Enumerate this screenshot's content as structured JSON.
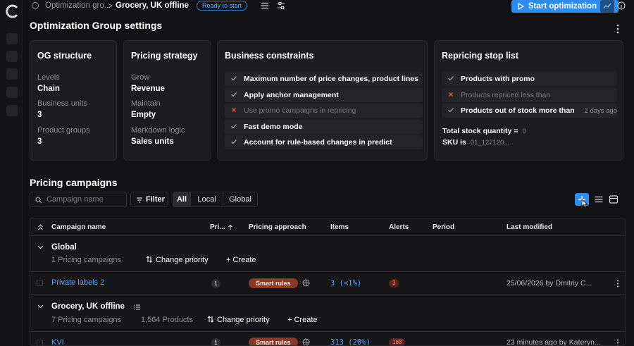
{
  "breadcrumb": {
    "parent": "Optimization gro...",
    "current": "Grocery, UK offline",
    "status": "Ready to start"
  },
  "header": {
    "start_label": "Start optimization"
  },
  "settings": {
    "title": "Optimization Group settings",
    "og_structure": {
      "title": "OG structure",
      "fields": [
        {
          "label": "Levels",
          "value": "Chain"
        },
        {
          "label": "Business units",
          "value": "3"
        },
        {
          "label": "Product groups",
          "value": "3"
        }
      ]
    },
    "pricing_strategy": {
      "title": "Pricing strategy",
      "fields": [
        {
          "label": "Grow",
          "value": "Revenue"
        },
        {
          "label": "Maintain",
          "value": "Empty"
        },
        {
          "label": "Markdown logic",
          "value": "Sales units"
        }
      ]
    },
    "business_constraints": {
      "title": "Business constraints",
      "items": [
        {
          "label": "Maximum number of price changes, product lines",
          "enabled": true
        },
        {
          "label": "Apply anchor management",
          "enabled": true
        },
        {
          "label": "Use promo campaigns in repricing",
          "enabled": false
        },
        {
          "label": "Fast demo mode",
          "enabled": true
        },
        {
          "label": "Account for rule-based changes in predict",
          "enabled": true
        }
      ]
    },
    "stop_list": {
      "title": "Repricing stop list",
      "items": [
        {
          "label": "Products with promo",
          "enabled": true,
          "meta": ""
        },
        {
          "label": "Products repriced less than",
          "enabled": false,
          "meta": ""
        },
        {
          "label": "Products out of stock more than",
          "enabled": true,
          "meta": "2 days ago"
        }
      ],
      "total_stock_label": "Total stock quantity =",
      "total_stock_value": "0",
      "sku_label": "SKU is",
      "sku_value": "01_127120..."
    }
  },
  "campaigns": {
    "title": "Pricing campaigns",
    "search_placeholder": "Campaign name",
    "filter_label": "Filter",
    "scopes": [
      "All",
      "Local",
      "Global"
    ],
    "active_scope": "All",
    "columns": {
      "name": "Campaign name",
      "priority": "Pri...",
      "approach": "Pricing approach",
      "items": "Items",
      "alerts": "Alerts",
      "period": "Period",
      "modified": "Last modified"
    },
    "groups": [
      {
        "title": "Global",
        "count_label": "1 Pricing campaigns",
        "products_label": "",
        "change_priority": "Change priority",
        "create": "+ Create",
        "rows": [
          {
            "name": "Private labels 2",
            "priority": "1",
            "approach": "Smart rules",
            "items": "3 (<1%)",
            "alerts": "3",
            "modified": "25/06/2026 by Dmitriy C..."
          }
        ]
      },
      {
        "title": "Grocery, UK offline",
        "count_label": "7 Pricing campaigns",
        "products_label": "1,564 Products",
        "change_priority": "Change priority",
        "create": "+ Create",
        "rows": [
          {
            "name": "KVI",
            "priority": "1",
            "approach": "Smart rules",
            "items": "313 (20%)",
            "alerts": "188",
            "modified": "23 minutes ago by Kateryn..."
          }
        ]
      }
    ]
  },
  "colors": {
    "background": "#121214",
    "card": "#1c1c1f",
    "accent": "#2d8cf0",
    "link": "#5aa9ff",
    "smart_rules": "#8a3a24",
    "alert": "#5a2320"
  }
}
